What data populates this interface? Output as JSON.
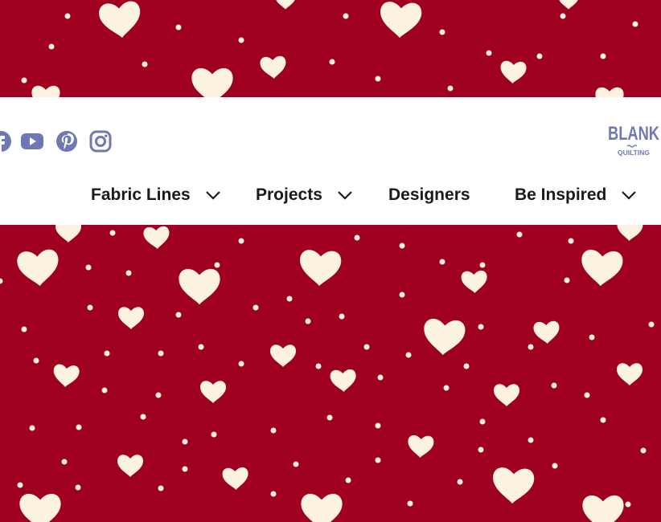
{
  "colors": {
    "background": "#a00020",
    "hearts": "#fbf3df",
    "header": "#ffffff",
    "social_icons": "#6f78b3",
    "nav_text": "#1a1a1a"
  },
  "social": {
    "items": [
      {
        "name": "facebook-icon"
      },
      {
        "name": "youtube-icon"
      },
      {
        "name": "pinterest-icon"
      },
      {
        "name": "instagram-icon"
      }
    ]
  },
  "logo": {
    "brand": "BLANK",
    "sub": "QUILTING"
  },
  "nav": {
    "items": [
      {
        "label": "Fabric Lines",
        "has_dropdown": true
      },
      {
        "label": "Projects",
        "has_dropdown": true
      },
      {
        "label": "Designers",
        "has_dropdown": false
      },
      {
        "label": "Be Inspired",
        "has_dropdown": true
      }
    ]
  }
}
